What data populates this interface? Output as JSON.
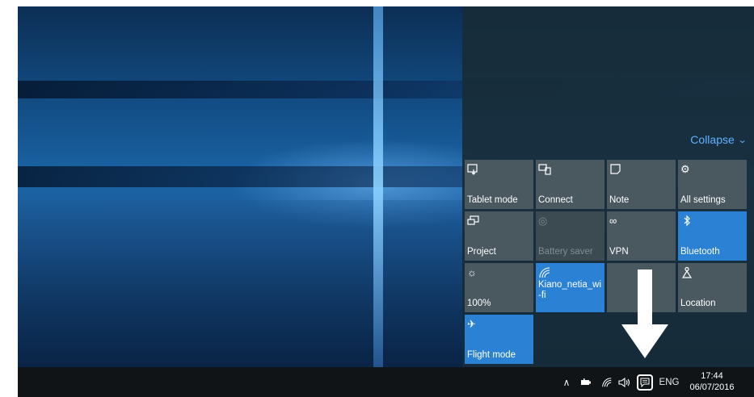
{
  "action_center": {
    "collapse_label": "Collapse",
    "tiles": [
      {
        "label": "Tablet mode",
        "icon": "tablet-mode-icon",
        "state": "default"
      },
      {
        "label": "Connect",
        "icon": "connect-icon",
        "state": "default"
      },
      {
        "label": "Note",
        "icon": "note-icon",
        "state": "default"
      },
      {
        "label": "All settings",
        "icon": "gear-icon",
        "state": "default"
      },
      {
        "label": "Project",
        "icon": "project-icon",
        "state": "default"
      },
      {
        "label": "Battery saver",
        "icon": "battery-saver-icon",
        "state": "disabled"
      },
      {
        "label": "VPN",
        "icon": "vpn-icon",
        "state": "default"
      },
      {
        "label": "Bluetooth",
        "icon": "bluetooth-icon",
        "state": "on"
      },
      {
        "label": "100%",
        "icon": "brightness-icon",
        "state": "default"
      },
      {
        "label": "Kiano_netia_wi\n-fi",
        "icon": "wifi-icon",
        "state": "on"
      },
      {
        "label": "",
        "icon": "",
        "state": "default"
      },
      {
        "label": "Location",
        "icon": "location-icon",
        "state": "default"
      },
      {
        "label": "Flight mode",
        "icon": "airplane-icon",
        "state": "on"
      }
    ]
  },
  "taskbar": {
    "language": "ENG",
    "time": "17:44",
    "date": "06/07/2016"
  },
  "colors": {
    "accent": "#2b82d4",
    "tile": "#4a5860",
    "panel": "#182c38",
    "link": "#5fb2ff"
  }
}
